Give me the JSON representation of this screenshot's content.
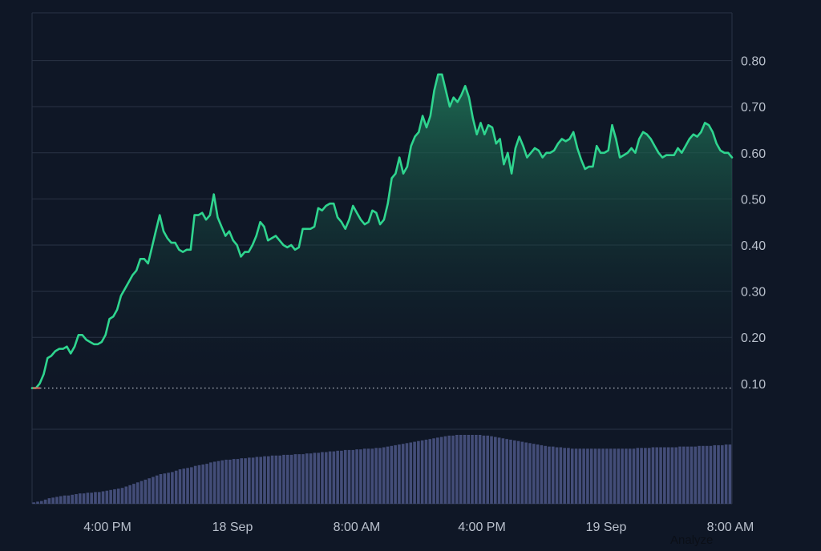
{
  "colors": {
    "background": "#0f1726",
    "grid": "#2a3345",
    "line": "#2fd58f",
    "fill_top": "#1f7a5a",
    "volume": "#434d78",
    "baseline": "#c9cfd9",
    "axis_text": "#b9c0cc"
  },
  "footer": {
    "analyze_label": "Analyze"
  },
  "chart_data": {
    "type": "area",
    "xlabel": "",
    "ylabel": "",
    "ylim": [
      0,
      0.9
    ],
    "x_ticks": [
      "4:00 PM",
      "18 Sep",
      "8:00 AM",
      "4:00 PM",
      "19 Sep",
      "8:00 AM"
    ],
    "y_ticks": [
      "0.10",
      "0.20",
      "0.30",
      "0.40",
      "0.50",
      "0.60",
      "0.70",
      "0.80"
    ],
    "y_tick_values": [
      0.1,
      0.2,
      0.3,
      0.4,
      0.5,
      0.6,
      0.7,
      0.8
    ],
    "baseline_value": 0.09,
    "grid": true,
    "price": [
      0.09,
      0.09,
      0.1,
      0.12,
      0.155,
      0.16,
      0.17,
      0.175,
      0.175,
      0.18,
      0.165,
      0.18,
      0.205,
      0.205,
      0.195,
      0.19,
      0.185,
      0.185,
      0.19,
      0.205,
      0.24,
      0.245,
      0.26,
      0.29,
      0.305,
      0.32,
      0.335,
      0.345,
      0.37,
      0.37,
      0.36,
      0.395,
      0.43,
      0.465,
      0.43,
      0.415,
      0.405,
      0.405,
      0.39,
      0.385,
      0.39,
      0.39,
      0.465,
      0.465,
      0.47,
      0.455,
      0.465,
      0.51,
      0.46,
      0.44,
      0.42,
      0.43,
      0.41,
      0.4,
      0.375,
      0.385,
      0.385,
      0.4,
      0.42,
      0.45,
      0.44,
      0.41,
      0.415,
      0.42,
      0.41,
      0.4,
      0.395,
      0.4,
      0.39,
      0.395,
      0.435,
      0.435,
      0.435,
      0.44,
      0.48,
      0.475,
      0.485,
      0.49,
      0.49,
      0.46,
      0.45,
      0.435,
      0.455,
      0.485,
      0.47,
      0.455,
      0.445,
      0.45,
      0.475,
      0.47,
      0.445,
      0.455,
      0.49,
      0.545,
      0.555,
      0.59,
      0.555,
      0.57,
      0.615,
      0.635,
      0.645,
      0.68,
      0.655,
      0.68,
      0.735,
      0.77,
      0.77,
      0.735,
      0.7,
      0.72,
      0.71,
      0.725,
      0.745,
      0.72,
      0.675,
      0.64,
      0.665,
      0.64,
      0.66,
      0.655,
      0.62,
      0.63,
      0.575,
      0.6,
      0.555,
      0.61,
      0.635,
      0.615,
      0.59,
      0.6,
      0.61,
      0.605,
      0.59,
      0.6,
      0.6,
      0.605,
      0.62,
      0.63,
      0.625,
      0.63,
      0.645,
      0.61,
      0.585,
      0.565,
      0.57,
      0.57,
      0.615,
      0.6,
      0.6,
      0.605,
      0.66,
      0.63,
      0.59,
      0.595,
      0.6,
      0.61,
      0.6,
      0.63,
      0.645,
      0.64,
      0.63,
      0.615,
      0.6,
      0.59,
      0.595,
      0.595,
      0.595,
      0.61,
      0.6,
      0.615,
      0.63,
      0.64,
      0.635,
      0.645,
      0.665,
      0.66,
      0.645,
      0.62,
      0.605,
      0.6,
      0.6,
      0.59
    ],
    "volume_relative": [
      0.02,
      0.03,
      0.04,
      0.06,
      0.08,
      0.09,
      0.1,
      0.11,
      0.12,
      0.12,
      0.13,
      0.14,
      0.15,
      0.15,
      0.16,
      0.16,
      0.17,
      0.17,
      0.18,
      0.19,
      0.2,
      0.21,
      0.22,
      0.23,
      0.25,
      0.27,
      0.29,
      0.31,
      0.33,
      0.35,
      0.37,
      0.39,
      0.41,
      0.43,
      0.44,
      0.45,
      0.46,
      0.48,
      0.5,
      0.51,
      0.52,
      0.53,
      0.55,
      0.56,
      0.57,
      0.58,
      0.6,
      0.61,
      0.62,
      0.63,
      0.64,
      0.64,
      0.65,
      0.65,
      0.66,
      0.66,
      0.67,
      0.67,
      0.68,
      0.68,
      0.69,
      0.69,
      0.7,
      0.7,
      0.7,
      0.71,
      0.71,
      0.71,
      0.72,
      0.72,
      0.72,
      0.73,
      0.73,
      0.74,
      0.74,
      0.75,
      0.75,
      0.76,
      0.76,
      0.77,
      0.77,
      0.78,
      0.78,
      0.78,
      0.79,
      0.79,
      0.8,
      0.8,
      0.8,
      0.81,
      0.81,
      0.82,
      0.83,
      0.84,
      0.85,
      0.86,
      0.87,
      0.88,
      0.89,
      0.9,
      0.91,
      0.92,
      0.93,
      0.94,
      0.95,
      0.96,
      0.97,
      0.98,
      0.99,
      0.99,
      1.0,
      1.0,
      1.0,
      1.0,
      1.0,
      1.0,
      1.0,
      0.99,
      0.99,
      0.98,
      0.97,
      0.96,
      0.95,
      0.94,
      0.93,
      0.92,
      0.91,
      0.9,
      0.89,
      0.88,
      0.87,
      0.86,
      0.85,
      0.84,
      0.83,
      0.83,
      0.82,
      0.82,
      0.81,
      0.81,
      0.8,
      0.8,
      0.8,
      0.8,
      0.8,
      0.8,
      0.8,
      0.8,
      0.8,
      0.8,
      0.8,
      0.8,
      0.8,
      0.8,
      0.8,
      0.8,
      0.8,
      0.81,
      0.81,
      0.81,
      0.81,
      0.82,
      0.82,
      0.82,
      0.82,
      0.82,
      0.82,
      0.82,
      0.83,
      0.83,
      0.83,
      0.83,
      0.83,
      0.84,
      0.84,
      0.84,
      0.84,
      0.85,
      0.85,
      0.85,
      0.86,
      0.86
    ]
  }
}
